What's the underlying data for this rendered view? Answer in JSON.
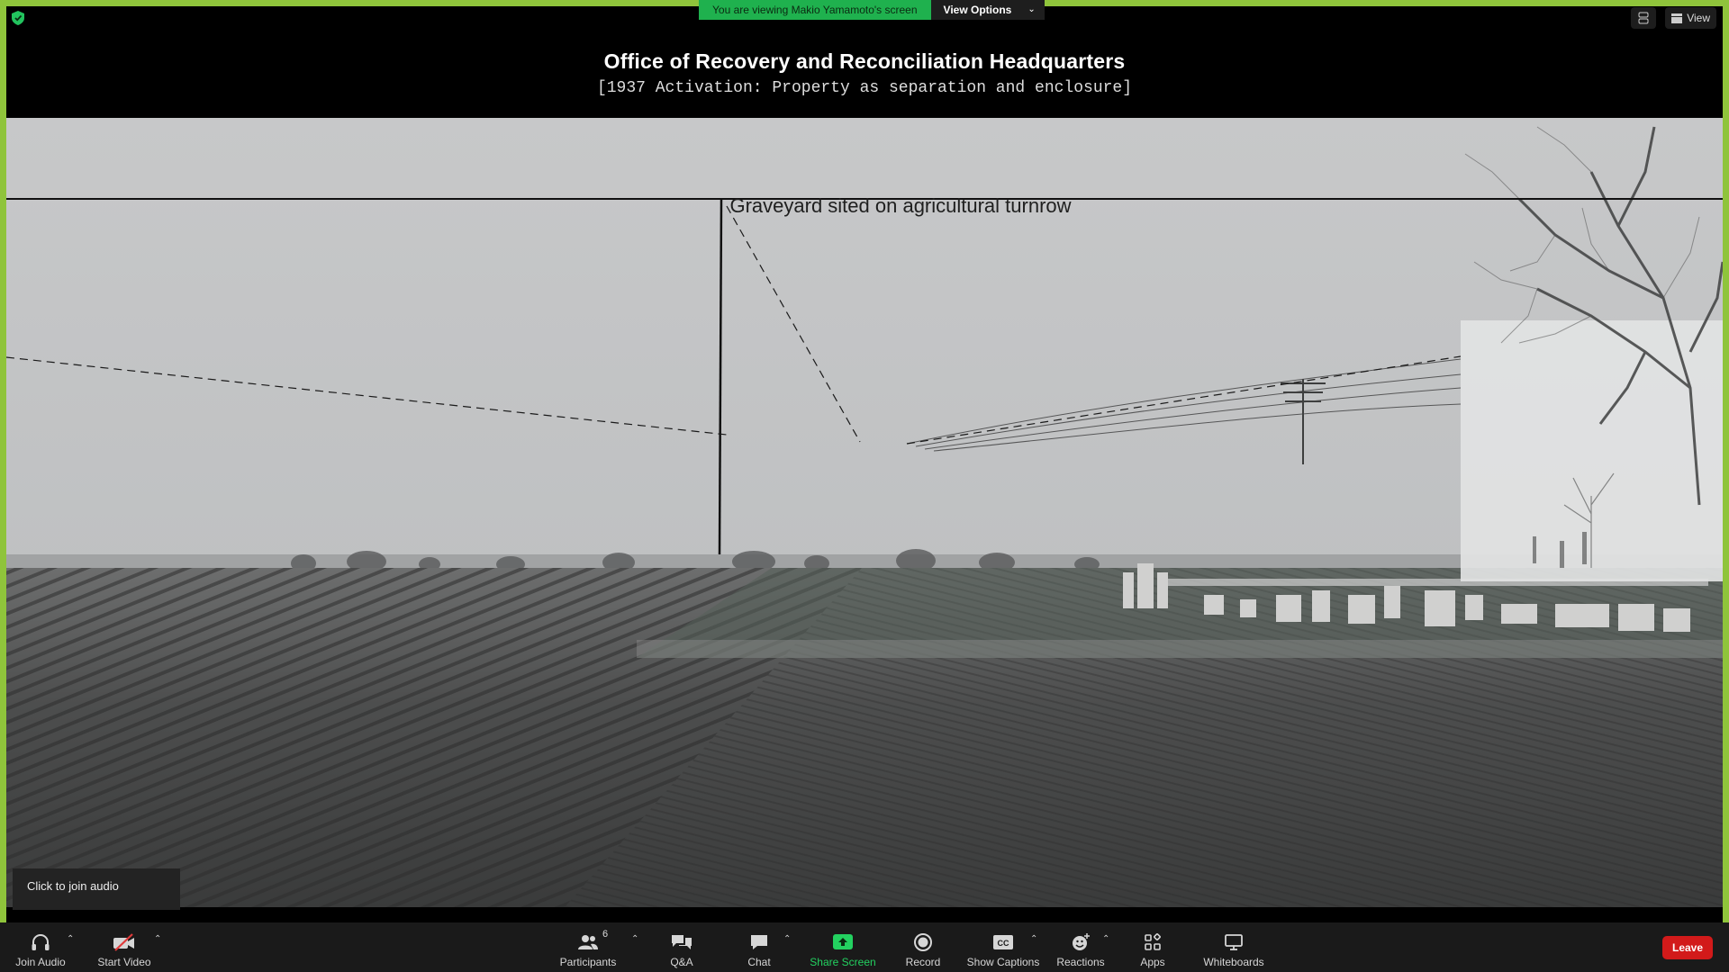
{
  "banner": {
    "viewing_text": "You are viewing Makio Yamamoto's screen",
    "view_options_label": "View Options"
  },
  "top_right": {
    "view_label": "View"
  },
  "slide": {
    "title": "Office of Recovery and Reconciliation  Headquarters",
    "subtitle": "[1937 Activation: Property as separation and enclosure]",
    "caption": "Graveyard sited on agricultural turnrow"
  },
  "audio_tip": "Click to join audio",
  "toolbar": {
    "join_audio": "Join Audio",
    "start_video": "Start Video",
    "participants": "Participants",
    "participant_count": "6",
    "qa": "Q&A",
    "chat": "Chat",
    "share_screen": "Share Screen",
    "record": "Record",
    "show_captions": "Show Captions",
    "reactions": "Reactions",
    "apps": "Apps",
    "whiteboards": "Whiteboards",
    "leave": "Leave"
  },
  "colors": {
    "share_frame": "#8fc43b",
    "banner_green": "#1fb14e",
    "leave_red": "#d21a1a",
    "share_icon_green": "#23d160"
  },
  "icons": [
    "shield-icon",
    "gallery-icon",
    "headphones-icon",
    "video-off-icon",
    "participants-icon",
    "qa-icon",
    "chat-icon",
    "share-screen-icon",
    "record-icon",
    "captions-icon",
    "reactions-icon",
    "apps-icon",
    "whiteboard-icon"
  ]
}
